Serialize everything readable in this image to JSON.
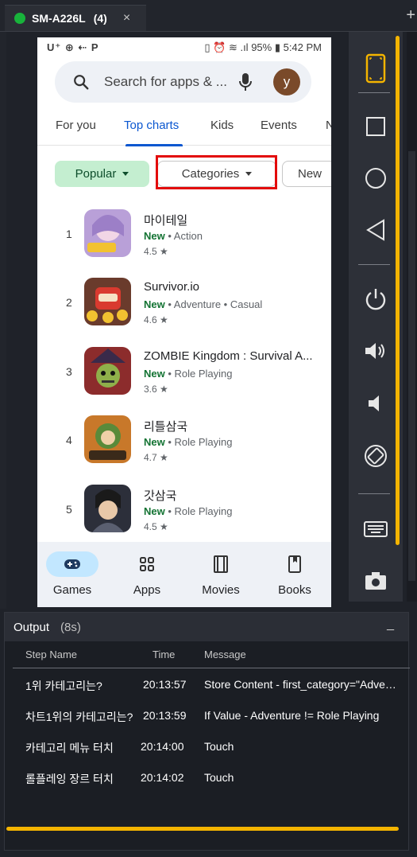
{
  "tab": {
    "title": "SM-A226L",
    "count": "(4)",
    "close": "×",
    "plus": "+"
  },
  "phone": {
    "status_left": "U⁺ ⊕ ⇠ P",
    "status_right": "95% ▮ 5:42 PM",
    "search_placeholder": "Search for apps & ...",
    "avatar_letter": "y",
    "nav_tabs": [
      "For you",
      "Top charts",
      "Kids",
      "Events",
      "N"
    ],
    "chips": {
      "popular": "Popular",
      "categories": "Categories",
      "new": "New"
    },
    "apps": [
      {
        "rank": "1",
        "name": "마이테일",
        "new": "New",
        "genre": "Action",
        "rating": "4.5 ★"
      },
      {
        "rank": "2",
        "name": "Survivor.io",
        "new": "New",
        "genre": "Adventure • Casual",
        "rating": "4.6 ★"
      },
      {
        "rank": "3",
        "name": "ZOMBIE Kingdom : Survival A...",
        "new": "New",
        "genre": "Role Playing",
        "rating": "3.6 ★"
      },
      {
        "rank": "4",
        "name": "리틀삼국",
        "new": "New",
        "genre": "Role Playing",
        "rating": "4.7 ★"
      },
      {
        "rank": "5",
        "name": "갓삼국",
        "new": "New",
        "genre": "Role Playing",
        "rating": "4.5 ★"
      }
    ],
    "bottom_nav": [
      "Games",
      "Apps",
      "Movies",
      "Books"
    ]
  },
  "output": {
    "title": "Output",
    "duration": "(8s)",
    "minimize": "_",
    "columns": {
      "step": "Step Name",
      "time": "Time",
      "message": "Message"
    },
    "rows": [
      {
        "step": "1위 카테고리는?",
        "time": "20:13:57",
        "message": "Store Content - first_category=\"Adventure\""
      },
      {
        "step": "차트1위의 카테고리는?",
        "time": "20:13:59",
        "message": "If Value - Adventure != Role Playing"
      },
      {
        "step": "카테고리 메뉴 터치",
        "time": "20:14:00",
        "message": "Touch"
      },
      {
        "step": "롤플레잉 장르 터치",
        "time": "20:14:02",
        "message": "Touch"
      }
    ]
  },
  "colors": {
    "accent": "#f4b400",
    "highlight": "#e30b0b",
    "active_tab": "#0b57d0",
    "device_dot": "#18b33b"
  }
}
